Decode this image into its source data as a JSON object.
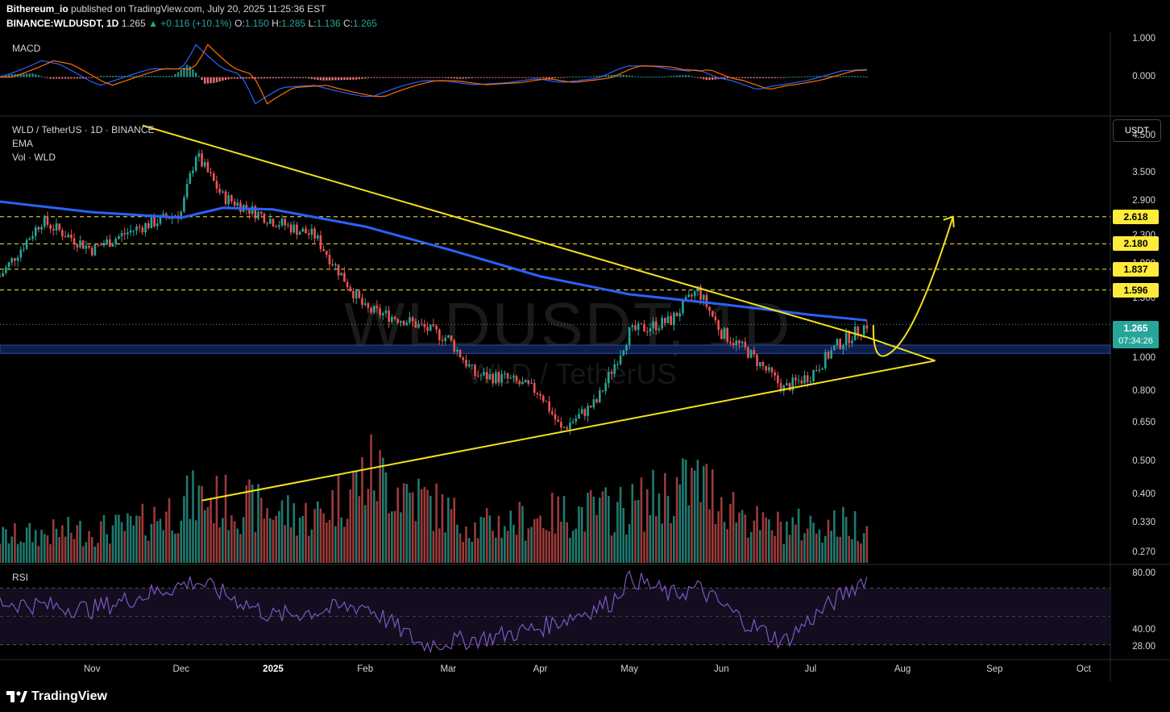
{
  "header": {
    "author": "Bithereum_io",
    "published": "published on TradingView.com, July 20, 2025 11:25:36 EST",
    "symbol": "BINANCE:WLDUSDT, 1D",
    "last": "1.265",
    "change": "▲ +0.116 (+10.1%)",
    "o_label": "O:",
    "o": "1.150",
    "h_label": "H:",
    "h": "1.285",
    "l_label": "L:",
    "l": "1.136",
    "c_label": "C:",
    "c": "1.265"
  },
  "panes": {
    "macd_label": "MACD",
    "main_title": "WLD / TetherUS · 1D · BINANCE",
    "ema_label": "EMA",
    "vol_label": "Vol · WLD",
    "rsi_label": "RSI"
  },
  "watermark": {
    "symbol": "WLDUSDT, 1D",
    "name": "WLD / TetherUS"
  },
  "price_axis": {
    "currency_button": "USDT",
    "macd_ticks": [
      "1.000",
      "0.000"
    ],
    "price_ticks": [
      "4.500",
      "3.500",
      "2.900",
      "2.300",
      "1.900",
      "1.500",
      "1.000",
      "0.800",
      "0.650",
      "0.500",
      "0.400",
      "0.330",
      "0.270"
    ],
    "rsi_ticks": [
      "80.00",
      "40.00",
      "28.00"
    ],
    "level_tags": [
      "2.618",
      "2.180",
      "1.837",
      "1.596"
    ],
    "current_price": "1.265",
    "countdown": "07:34:26"
  },
  "time_axis": [
    "Nov",
    "Dec",
    "2025",
    "Feb",
    "Mar",
    "Apr",
    "May",
    "Jun",
    "Jul",
    "Aug",
    "Sep",
    "Oct"
  ],
  "colors": {
    "up": "#26a69a",
    "down": "#ef5350",
    "ema": "#2962ff",
    "trend": "#f5e11b",
    "rsi": "#7e57c2",
    "macd": "#2962ff",
    "signal": "#ff6d00",
    "level": "#ffeb3b"
  },
  "footer": {
    "brand": "TradingView"
  },
  "chart_data": {
    "type": "candlestick",
    "title": "WLD / TetherUS · 1D · BINANCE",
    "scale": "log",
    "ylim": [
      0.25,
      5.0
    ],
    "x_range": [
      "2024-10-01",
      "2025-10-10"
    ],
    "series": [
      {
        "name": "WLD / TetherUS",
        "type": "close",
        "x": [
          "2024-10-01",
          "2024-10-15",
          "2024-11-01",
          "2024-11-15",
          "2024-12-01",
          "2024-12-06",
          "2024-12-15",
          "2025-01-01",
          "2025-01-15",
          "2025-02-01",
          "2025-02-15",
          "2025-03-01",
          "2025-03-10",
          "2025-03-20",
          "2025-04-01",
          "2025-04-08",
          "2025-04-20",
          "2025-05-01",
          "2025-05-15",
          "2025-05-24",
          "2025-06-01",
          "2025-06-10",
          "2025-06-22",
          "2025-07-01",
          "2025-07-10",
          "2025-07-20"
        ],
        "values": [
          1.75,
          2.55,
          2.1,
          2.4,
          2.7,
          4.0,
          3.0,
          2.55,
          2.3,
          1.4,
          1.3,
          1.15,
          0.9,
          0.88,
          0.8,
          0.62,
          0.75,
          1.2,
          1.3,
          1.6,
          1.2,
          1.05,
          0.82,
          0.9,
          1.1,
          1.265
        ]
      },
      {
        "name": "EMA",
        "type": "line",
        "x": [
          "2024-10-01",
          "2024-11-01",
          "2024-12-01",
          "2024-12-15",
          "2025-01-01",
          "2025-02-01",
          "2025-03-01",
          "2025-04-01",
          "2025-05-01",
          "2025-06-01",
          "2025-07-01",
          "2025-07-20"
        ],
        "values": [
          2.9,
          2.7,
          2.6,
          2.78,
          2.75,
          2.45,
          2.1,
          1.75,
          1.55,
          1.45,
          1.35,
          1.3
        ]
      }
    ],
    "volume": {
      "x": [
        "2024-10-01",
        "2024-11-15",
        "2024-12-06",
        "2025-01-15",
        "2025-02-03",
        "2025-03-10",
        "2025-04-08",
        "2025-05-01",
        "2025-05-24",
        "2025-06-15",
        "2025-07-15"
      ],
      "values": [
        40,
        55,
        100,
        70,
        140,
        55,
        75,
        85,
        125,
        55,
        60
      ]
    },
    "trendlines": [
      {
        "name": "resistance",
        "from": [
          "2024-11-18",
          4.85
        ],
        "to": [
          "2025-07-20",
          1.16
        ]
      },
      {
        "name": "support",
        "from": [
          "2024-12-08",
          0.385
        ],
        "to": [
          "2025-08-12",
          0.99
        ]
      }
    ],
    "horizontal_levels": [
      2.618,
      2.18,
      1.837,
      1.596
    ],
    "support_zone": [
      1.04,
      1.1
    ],
    "projection": {
      "from": [
        "2025-07-20",
        1.26
      ],
      "via": [
        "2025-07-23",
        1.08
      ],
      "to": [
        "2025-08-18",
        2.618
      ]
    },
    "macd": {
      "ylim": [
        -1.0,
        1.2
      ],
      "ticks": [
        1.0,
        0.0
      ]
    },
    "rsi": {
      "ylim": [
        20,
        85
      ],
      "ticks": [
        80,
        40,
        28
      ],
      "bands": [
        30,
        70
      ],
      "x": [
        "2024-10-01",
        "2024-11-01",
        "2024-12-06",
        "2025-01-01",
        "2025-02-01",
        "2025-02-20",
        "2025-03-15",
        "2025-04-01",
        "2025-04-25",
        "2025-05-01",
        "2025-05-15",
        "2025-05-24",
        "2025-06-10",
        "2025-06-22",
        "2025-07-01",
        "2025-07-20"
      ],
      "values": [
        60,
        55,
        75,
        50,
        58,
        30,
        35,
        42,
        60,
        78,
        65,
        70,
        45,
        32,
        48,
        78
      ]
    }
  }
}
